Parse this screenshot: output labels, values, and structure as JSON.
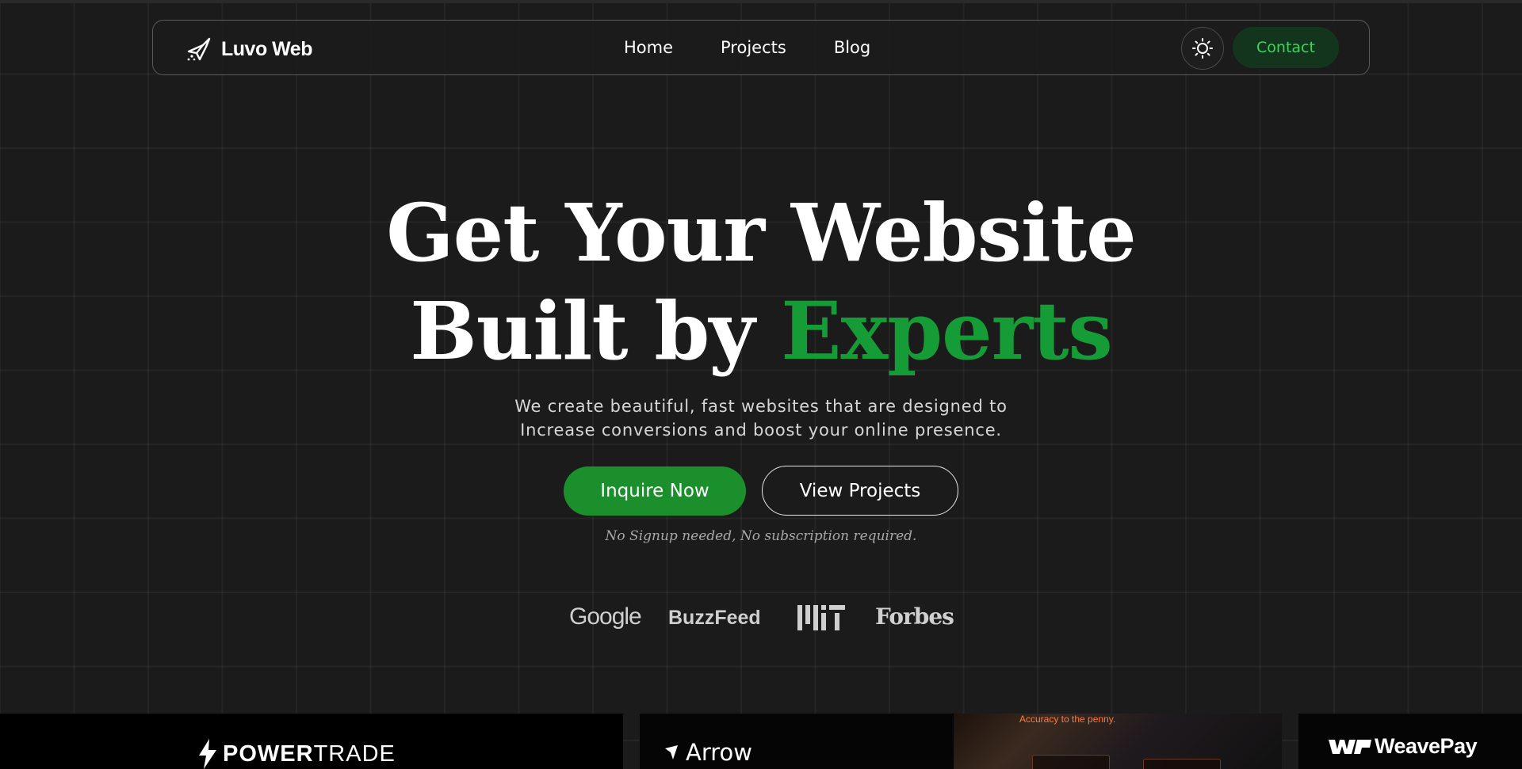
{
  "nav": {
    "brand": "Luvo Web",
    "links": [
      "Home",
      "Projects",
      "Blog"
    ],
    "theme_toggle_icon": "sun-icon",
    "contact_label": "Contact"
  },
  "hero": {
    "title_line1": "Get Your Website",
    "title_line2_prefix": "Built by ",
    "title_line2_accent": "Experts",
    "subtitle_line1": "We create beautiful, fast websites that are designed to",
    "subtitle_line2": "Increase conversions and boost your online presence.",
    "primary_button": "Inquire Now",
    "secondary_button": "View Projects",
    "note": "No Signup needed, No subscription required."
  },
  "brands": {
    "google": "Google",
    "buzzfeed": "BuzzFeed",
    "mit": "MIT",
    "forbes": "Forbes"
  },
  "showcase": {
    "powertrade_bold": "POWER",
    "powertrade_light": "TRADE",
    "arrow": "Arrow",
    "screenshot_headline": "Accuracy to the penny.",
    "weavepay": "WeavePay"
  },
  "colors": {
    "accent_green": "#169c36",
    "button_green": "#1b8f2c",
    "contact_bg": "#14351d",
    "contact_text": "#3ad65c",
    "background": "#1b1b1b"
  }
}
